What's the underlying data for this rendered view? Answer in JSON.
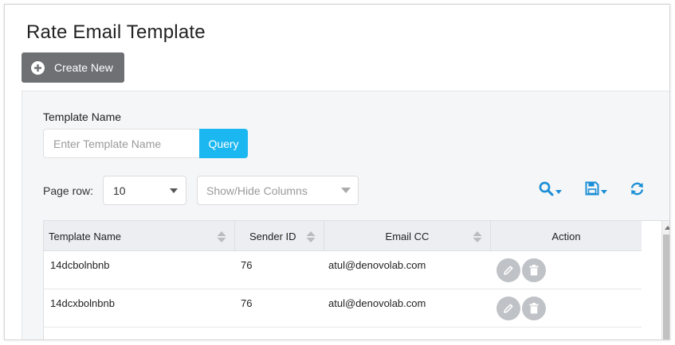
{
  "page": {
    "title": "Rate Email Template",
    "create_label": "Create New"
  },
  "filter": {
    "label": "Template Name",
    "placeholder": "Enter Template Name",
    "query_label": "Query"
  },
  "toolbar": {
    "page_row_label": "Page row:",
    "page_row_value": "10",
    "columns_placeholder": "Show/Hide Columns",
    "icons": [
      "search-icon",
      "save-icon",
      "refresh-icon"
    ]
  },
  "table": {
    "columns": [
      "Template Name",
      "Sender ID",
      "Email CC",
      "Action"
    ],
    "rows": [
      {
        "name": "14dcbolnbnb",
        "sender": "76",
        "cc": "atul@denovolab.com"
      },
      {
        "name": "14dcxbolnbnb",
        "sender": "76",
        "cc": "atul@denovolab.com"
      }
    ]
  },
  "colors": {
    "accent": "#1bb7f0",
    "icon_blue": "#1a8ed6",
    "dark_button": "#6e7073",
    "action_circle": "#bfc2c6"
  }
}
